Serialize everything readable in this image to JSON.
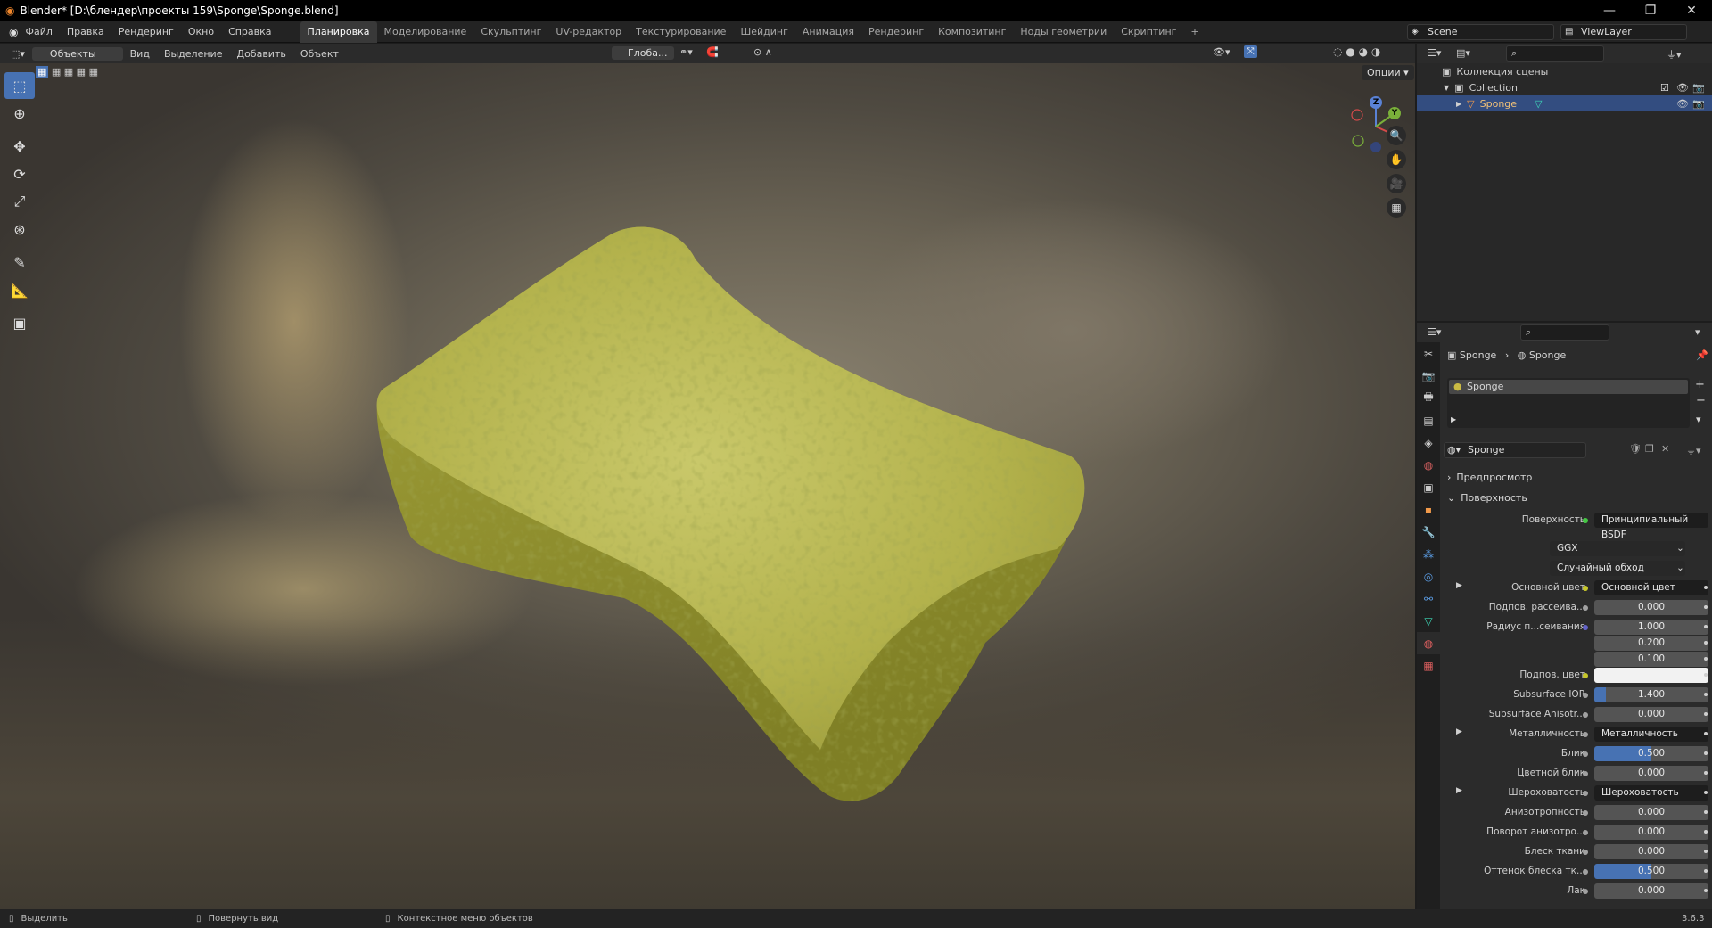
{
  "window": {
    "title": "Blender* [D:\\блендер\\проекты 159\\Sponge\\Sponge.blend]"
  },
  "menu": [
    "Файл",
    "Правка",
    "Рендеринг",
    "Окно",
    "Справка"
  ],
  "workspaces": [
    "Планировка",
    "Моделирование",
    "Скульптинг",
    "UV-редактор",
    "Текстурирование",
    "Шейдинг",
    "Анимация",
    "Рендеринг",
    "Композитинг",
    "Ноды геометрии",
    "Скриптинг",
    "+"
  ],
  "scene": {
    "name": "Scene",
    "view_layer": "ViewLayer"
  },
  "viewport_header": {
    "mode": "Объекты",
    "items": [
      "Вид",
      "Выделение",
      "Добавить",
      "Объект"
    ],
    "transform": "Глоба...",
    "options": "Опции"
  },
  "gizmo": {
    "x": "X",
    "y": "Y",
    "z": "Z"
  },
  "outliner": {
    "scene_collection": "Коллекция сцены",
    "collection": "Collection",
    "object": "Sponge"
  },
  "properties": {
    "breadcrumb_object": "Sponge",
    "breadcrumb_material": "Sponge",
    "slot": "Sponge",
    "material_name": "Sponge",
    "sections": {
      "preview": "Предпросмотр",
      "surface": "Поверхность"
    },
    "surface_label": "Поверхность",
    "surface_shader": "Принципиальный BSDF",
    "distribution": "GGX",
    "subsurface_method": "Случайный обход",
    "rows": [
      {
        "label": "Основной цвет",
        "value": "Основной цвет",
        "type": "link",
        "dot": "#c7c729",
        "expand": true
      },
      {
        "label": "Подпов. рассеива...",
        "value": "0.000",
        "type": "num",
        "dot": "#a1a1a1"
      },
      {
        "label": "Радиус п...сеивания",
        "value": "1.000",
        "type": "num",
        "dot": "#6363c7"
      },
      {
        "label": "",
        "value": "0.200",
        "type": "num",
        "dot": ""
      },
      {
        "label": "",
        "value": "0.100",
        "type": "num",
        "dot": ""
      },
      {
        "label": "Подпов. цвет",
        "value": "",
        "type": "color",
        "dot": "#c7c729"
      },
      {
        "label": "Subsurface IOR",
        "value": "1.400",
        "type": "slider",
        "fill": 0.1,
        "dot": "#a1a1a1"
      },
      {
        "label": "Subsurface Anisotr...",
        "value": "0.000",
        "type": "num",
        "dot": "#a1a1a1"
      },
      {
        "label": "Металличность",
        "value": "Металличность",
        "type": "link",
        "dot": "#a1a1a1",
        "expand": true
      },
      {
        "label": "Блик",
        "value": "0.500",
        "type": "slider",
        "fill": 0.5,
        "dot": "#a1a1a1"
      },
      {
        "label": "Цветной блик",
        "value": "0.000",
        "type": "num",
        "dot": "#a1a1a1"
      },
      {
        "label": "Шероховатость",
        "value": "Шероховатость",
        "type": "link",
        "dot": "#a1a1a1",
        "expand": true
      },
      {
        "label": "Анизотропность",
        "value": "0.000",
        "type": "num",
        "dot": "#a1a1a1"
      },
      {
        "label": "Поворот анизотро...",
        "value": "0.000",
        "type": "num",
        "dot": "#a1a1a1"
      },
      {
        "label": "Блеск ткани",
        "value": "0.000",
        "type": "num",
        "dot": "#a1a1a1"
      },
      {
        "label": "Оттенок блеска тк...",
        "value": "0.500",
        "type": "slider",
        "fill": 0.5,
        "dot": "#a1a1a1"
      },
      {
        "label": "Лак",
        "value": "0.000",
        "type": "num",
        "dot": "#a1a1a1"
      }
    ]
  },
  "status": {
    "select": "Выделить",
    "rotate": "Повернуть вид",
    "context": "Контекстное меню объектов",
    "version": "3.6.3"
  }
}
